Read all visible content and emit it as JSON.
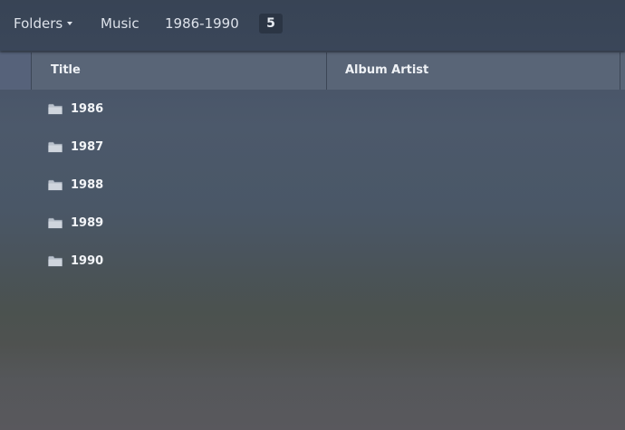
{
  "breadcrumb": {
    "folders_label": "Folders",
    "music_label": "Music",
    "current_label": "1986-1990",
    "count": "5"
  },
  "table": {
    "columns": [
      {
        "label": "Title"
      },
      {
        "label": "Album Artist"
      }
    ],
    "rows": [
      {
        "title": "1986",
        "icon": "folder-icon"
      },
      {
        "title": "1987",
        "icon": "folder-icon"
      },
      {
        "title": "1988",
        "icon": "folder-icon"
      },
      {
        "title": "1989",
        "icon": "folder-icon"
      },
      {
        "title": "1990",
        "icon": "folder-icon"
      }
    ]
  },
  "colors": {
    "topbar": "#384455",
    "header": "#596577",
    "text": "#f2f4f7",
    "folder": "#b9c1cc"
  }
}
